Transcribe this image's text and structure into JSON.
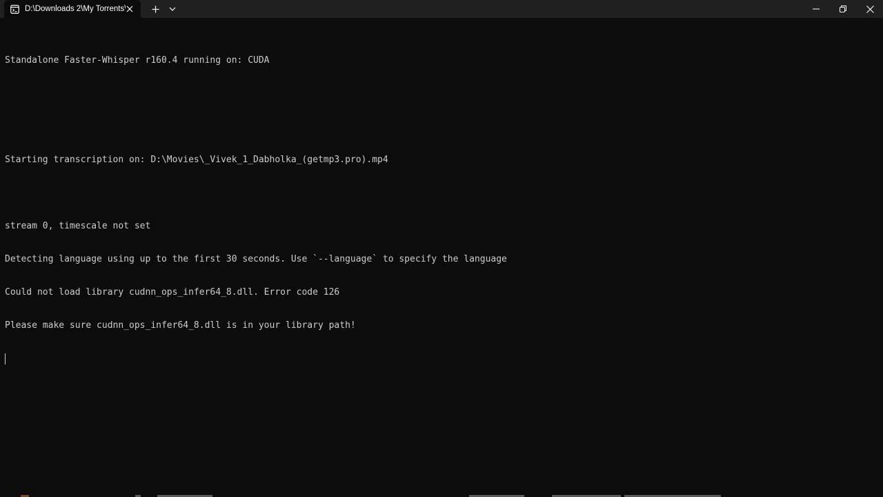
{
  "titlebar": {
    "tab_title": "D:\\Downloads 2\\My Torrents\\",
    "icons": {
      "tab": "terminal-icon",
      "close_tab": "close-icon",
      "new_tab": "plus-icon",
      "dropdown": "chevron-down-icon",
      "minimize": "minimize-icon",
      "maximize": "restore-icon",
      "close_window": "close-icon"
    }
  },
  "console": {
    "lines": [
      "Standalone Faster-Whisper r160.4 running on: CUDA",
      "Starting transcription on: D:\\Movies\\_Vivek_1_Dabholka_(getmp3.pro).mp4",
      "stream 0, timescale not set",
      "Detecting language using up to the first 30 seconds. Use `--language` to specify the language",
      "Could not load library cudnn_ops_infer64_8.dll. Error code 126",
      "Please make sure cudnn_ops_infer64_8.dll is in your library path!"
    ]
  },
  "colors": {
    "background": "#0c0c0c",
    "titlebar": "#202020",
    "text": "#cccccc"
  }
}
